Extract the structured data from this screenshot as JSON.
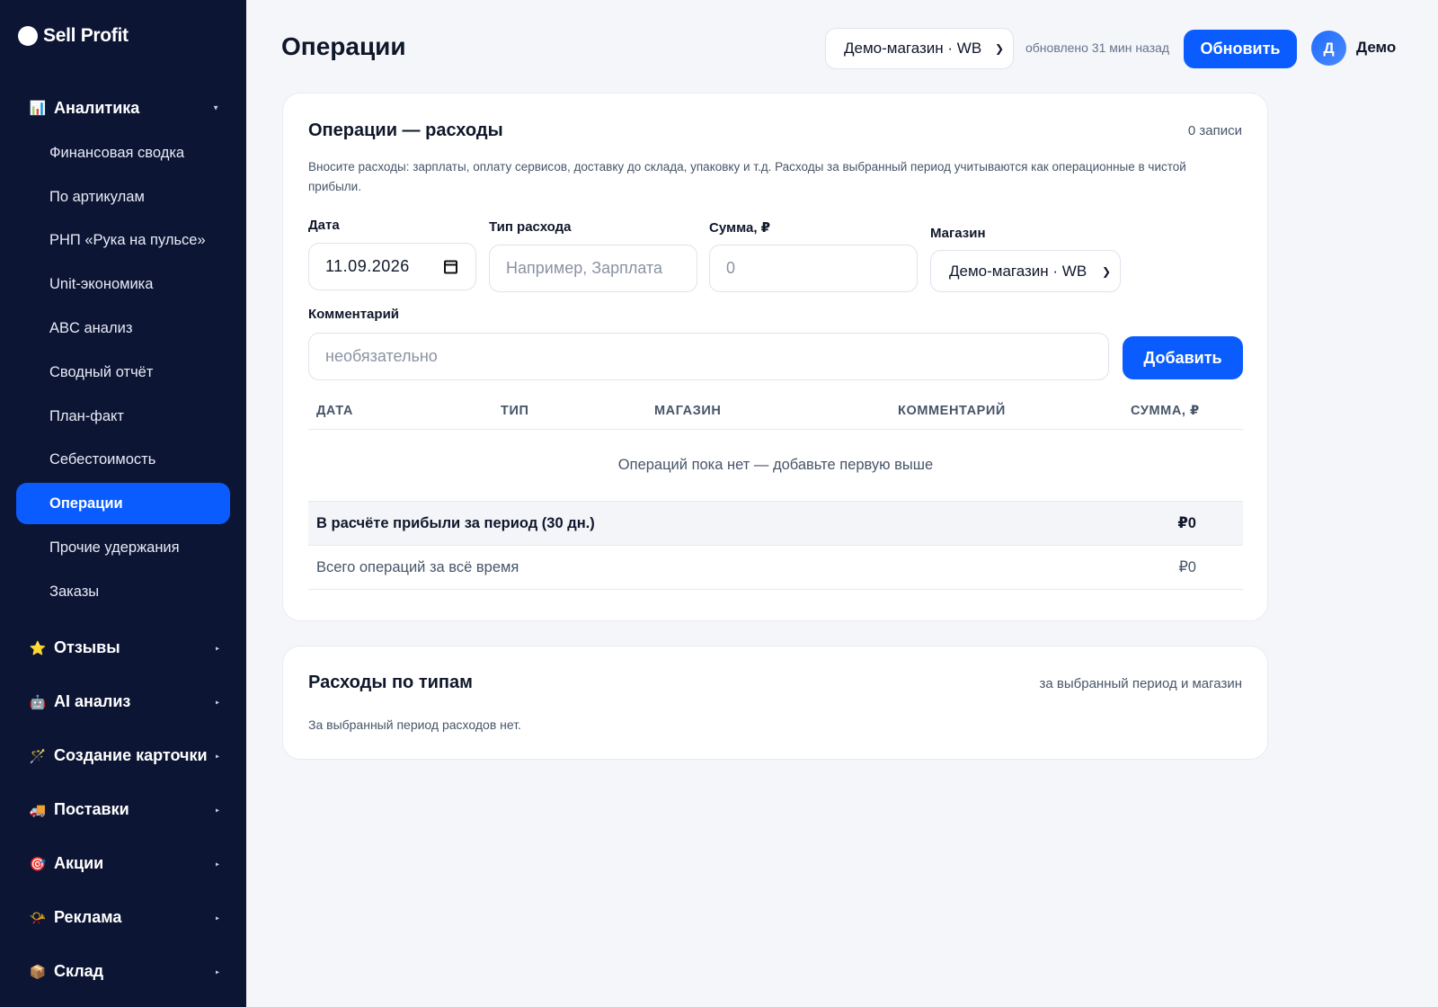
{
  "brand": {
    "name": "Sell Profit"
  },
  "sidebar": {
    "analytics": {
      "icon": "📊",
      "label": "Аналитика",
      "items": [
        "Финансовая сводка",
        "По артикулам",
        "РНП «Рука на пульсе»",
        "Unit-экономика",
        "ABC анализ",
        "Сводный отчёт",
        "План-факт",
        "Себестоимость",
        "Операции",
        "Прочие удержания",
        "Заказы"
      ],
      "active_item": "Операции"
    },
    "groups": [
      {
        "icon": "⭐",
        "label": "Отзывы"
      },
      {
        "icon": "🤖",
        "label": "AI анализ"
      },
      {
        "icon": "🪄",
        "label": "Создание карточки"
      },
      {
        "icon": "🚚",
        "label": "Поставки"
      },
      {
        "icon": "🎯",
        "label": "Акции"
      },
      {
        "icon": "📯",
        "label": "Реклама"
      },
      {
        "icon": "📦",
        "label": "Склад"
      }
    ]
  },
  "header": {
    "title": "Операции",
    "store_select": "Демо-магазин · WB",
    "updated": "обновлено 31 мин назад",
    "refresh_label": "Обновить",
    "avatar_letter": "Д",
    "user_name": "Демо"
  },
  "expenses": {
    "title": "Операции — расходы",
    "count": "0 записи",
    "description": "Вносите расходы: зарплаты, оплату сервисов, доставку до склада, упаковку и т.д. Расходы за выбранный период учитываются как операционные в чистой прибыли.",
    "form": {
      "date_label": "Дата",
      "date_value": "11.09.2026",
      "type_label": "Тип расхода",
      "type_placeholder": "Например, Зарплата",
      "amount_label": "Сумма, ₽",
      "amount_placeholder": "0",
      "store_label": "Магазин",
      "store_value": "Демо-магазин · WB",
      "comment_label": "Комментарий",
      "comment_placeholder": "необязательно",
      "add_label": "Добавить"
    },
    "table": {
      "columns": [
        "ДАТА",
        "ТИП",
        "МАГАЗИН",
        "КОММЕНТАРИЙ",
        "СУММА, ₽"
      ],
      "empty_text": "Операций пока нет — добавьте первую выше",
      "period_label": "В расчёте прибыли за период (30 дн.)",
      "period_total": "₽0",
      "all_time_label": "Всего операций за всё время",
      "all_time_total": "₽0"
    }
  },
  "by_type": {
    "title": "Расходы по типам",
    "meta": "за выбранный период и магазин",
    "empty_text": "За выбранный период расходов нет."
  },
  "colors": {
    "sidebar_bg": "#0c1534",
    "accent": "#0a5cff",
    "page_bg": "#f5f6fa"
  }
}
